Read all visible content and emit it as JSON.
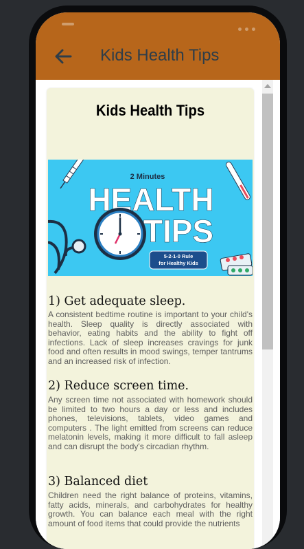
{
  "app_bar": {
    "title": "Kids Health Tips",
    "back_icon": "arrow-left-icon"
  },
  "colors": {
    "app_bar": "#b7661b",
    "card_background": "#f3f3dc",
    "banner_background": "#3cc8f2",
    "title_text": "#2e3d49"
  },
  "card": {
    "title": "Kids Health Tips",
    "banner": {
      "top_line": "2 Minutes",
      "word1": "HEALTH",
      "word2": "TIPS",
      "badge_line1": "5-2-1-0 Rule",
      "badge_line2": "for Healthy Kids"
    },
    "tips": [
      {
        "heading": "1) Get adequate sleep.",
        "body": "A consistent bedtime routine is important to your child's health. Sleep quality is directly associated with behavior, eating habits and the ability to fight off infections. Lack of sleep increases cravings for junk food and often results in mood swings, temper tantrums and an increased risk of infection."
      },
      {
        "heading": "2) Reduce screen time.",
        "body": "Any screen time not associated with homework should be limited to two hours a day or less and includes phones, televisions, tablets, video games and computers . The light emitted from screens can reduce melatonin levels, making it more difficult to fall asleep and can disrupt the body's circadian rhythm."
      },
      {
        "heading": "3) Balanced diet",
        "body": "Children need the right balance of proteins, vitamins, fatty acids, minerals, and carbohydrates for healthy growth. You can balance each meal with the right amount of food items that could provide the nutrients"
      }
    ]
  }
}
